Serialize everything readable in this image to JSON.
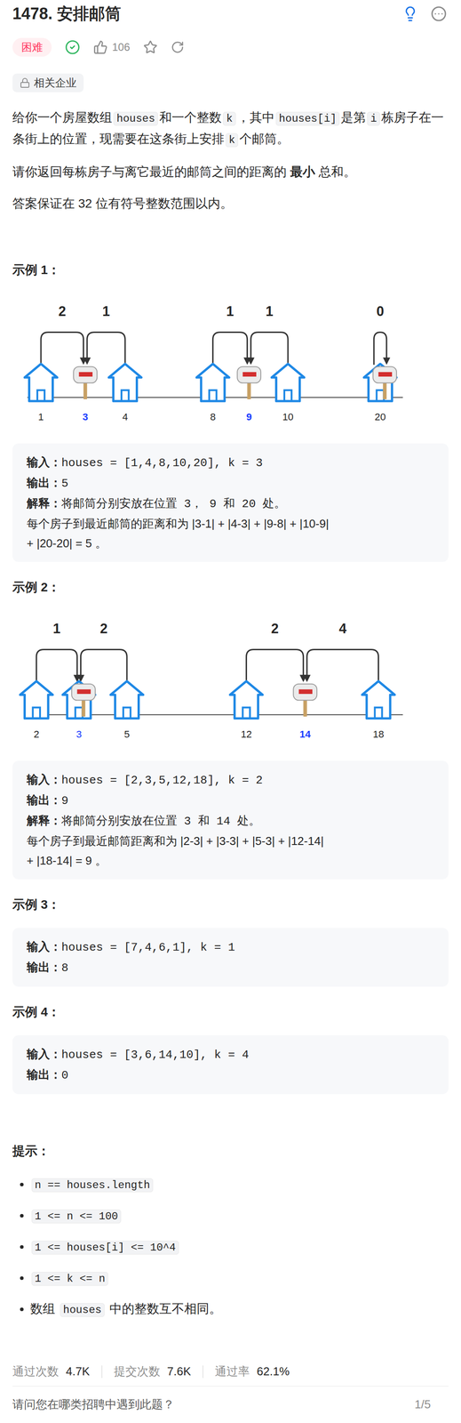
{
  "title": "1478. 安排邮筒",
  "difficulty": "困难",
  "solved": true,
  "likes": "106",
  "starred": false,
  "company_tag": "相关企业",
  "description": [
    [
      {
        "kind": "text",
        "text": "给你一个房屋数组"
      },
      {
        "kind": "code",
        "text": "houses"
      },
      {
        "kind": "text",
        "text": "和一个整数"
      },
      {
        "kind": "code",
        "text": "k"
      },
      {
        "kind": "text",
        "text": "，其中"
      },
      {
        "kind": "code",
        "text": "houses[i]"
      },
      {
        "kind": "text",
        "text": "是第"
      },
      {
        "kind": "code",
        "text": "i"
      },
      {
        "kind": "text",
        "text": "栋房子在一条街上的位置，现需要在这条街上安排"
      },
      {
        "kind": "code",
        "text": "k"
      },
      {
        "kind": "text",
        "text": "个邮筒。"
      }
    ],
    [
      {
        "kind": "text",
        "text": "请你返回每栋房子与离它最近的邮筒之间的距离的 "
      },
      {
        "kind": "bold",
        "text": "最小"
      },
      {
        "kind": "text",
        "text": " 总和。"
      }
    ],
    [
      {
        "kind": "text",
        "text": "答案保证在 32 位有符号整数范围以内。"
      }
    ]
  ],
  "examples": [
    {
      "heading": "示例 1：",
      "diagram": {
        "arcs": [
          {
            "label": "2"
          },
          {
            "label": "1"
          },
          {
            "label": "1"
          },
          {
            "label": "1"
          },
          {
            "label": "0"
          }
        ],
        "marks": [
          {
            "label": "1",
            "kind": "house",
            "color": "#262626"
          },
          {
            "label": "3",
            "kind": "mailbox",
            "color": "#1a3cff"
          },
          {
            "label": "4",
            "kind": "house",
            "color": "#262626"
          },
          {
            "label": "8",
            "kind": "house",
            "color": "#262626"
          },
          {
            "label": "9",
            "kind": "mailbox",
            "color": "#1a3cff"
          },
          {
            "label": "10",
            "kind": "house",
            "color": "#262626"
          },
          {
            "label": "20",
            "kind": "house-mailbox",
            "color": "#262626"
          }
        ]
      },
      "lines": [
        {
          "label": "输入：",
          "text": "houses = [1,4,8,10,20], k = 3"
        },
        {
          "label": "输出：",
          "text": "5"
        },
        {
          "label": "解释：",
          "text": "将邮筒分别安放在位置 3， 9 和 20 处。"
        },
        {
          "text": "每个房子到最近邮筒的距离和为 |3-1| + |4-3| + |9-8| + |10-9|"
        },
        {
          "text": "+ |20-20| = 5 。"
        }
      ]
    },
    {
      "heading": "示例 2：",
      "diagram": {
        "arcs": [
          {
            "label": "1"
          },
          {
            "label": "2"
          },
          {
            "label": "2"
          },
          {
            "label": "4"
          }
        ],
        "marks": [
          {
            "label": "2",
            "kind": "house",
            "color": "#262626"
          },
          {
            "label": "3",
            "kind": "house-mailbox",
            "color": "#1a3cff"
          },
          {
            "label": "5",
            "kind": "house",
            "color": "#262626"
          },
          {
            "label": "12",
            "kind": "house",
            "color": "#262626"
          },
          {
            "label": "14",
            "kind": "mailbox",
            "color": "#1a3cff"
          },
          {
            "label": "18",
            "kind": "house",
            "color": "#262626"
          }
        ]
      },
      "lines": [
        {
          "label": "输入：",
          "text": "houses = [2,3,5,12,18], k = 2"
        },
        {
          "label": "输出：",
          "text": "9"
        },
        {
          "label": "解释：",
          "text": "将邮筒分别安放在位置 3 和 14 处。"
        },
        {
          "text": "每个房子到最近邮筒距离和为 |2-3| + |3-3| + |5-3| + |12-14|"
        },
        {
          "text": "+ |18-14| = 9 。"
        }
      ]
    },
    {
      "heading": "示例 3：",
      "lines": [
        {
          "label": "输入：",
          "text": "houses = [7,4,6,1], k = 1"
        },
        {
          "label": "输出：",
          "text": "8"
        }
      ]
    },
    {
      "heading": "示例 4：",
      "lines": [
        {
          "label": "输入：",
          "text": "houses = [3,6,14,10], k = 4"
        },
        {
          "label": "输出：",
          "text": "0"
        }
      ]
    }
  ],
  "hints_heading": "提示：",
  "hints": [
    [
      {
        "kind": "code",
        "text": "n == houses.length"
      }
    ],
    [
      {
        "kind": "code",
        "text": "1 <= n <= 100"
      }
    ],
    [
      {
        "kind": "code",
        "text": "1 <= houses[i] <= 10^4"
      }
    ],
    [
      {
        "kind": "code",
        "text": "1 <= k <= n"
      }
    ],
    [
      {
        "kind": "text",
        "text": "数组 "
      },
      {
        "kind": "code",
        "text": "houses"
      },
      {
        "kind": "text",
        "text": " 中的整数互不相同。"
      }
    ]
  ],
  "stats": [
    {
      "label": "通过次数",
      "value": "4.7K"
    },
    {
      "label": "提交次数",
      "value": "7.6K"
    },
    {
      "label": "通过率",
      "value": "62.1%"
    }
  ],
  "survey": {
    "question": "请问您在哪类招聘中遇到此题？",
    "progress": "1/5"
  }
}
